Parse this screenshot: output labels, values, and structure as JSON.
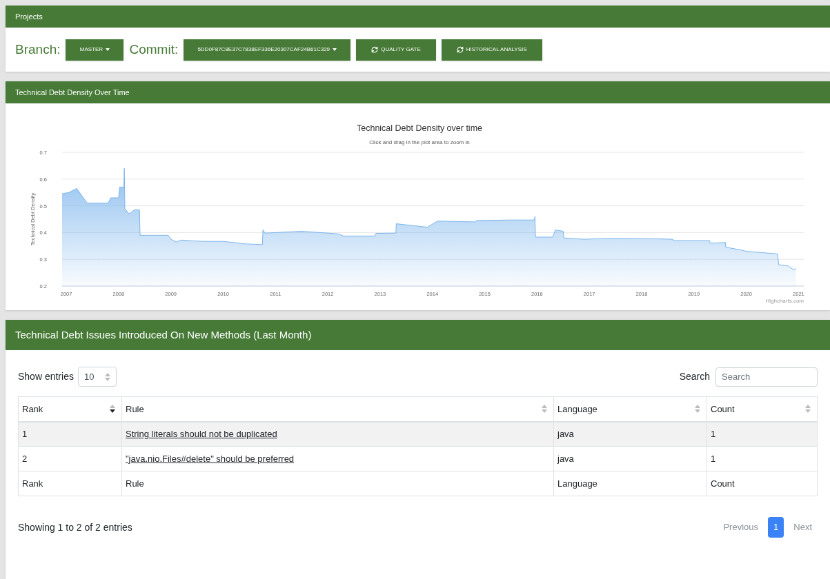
{
  "projects_panel": {
    "title": "Projects",
    "branch_label": "Branch:",
    "branch": "MASTER",
    "commit_label": "Commit:",
    "commit": "5DD0F87C8E37C7838EF336E20307CAF24B61C329",
    "actions": [
      {
        "label": "QUALITY GATE"
      },
      {
        "label": "HISTORICAL ANALYSIS"
      }
    ]
  },
  "chart_panel": {
    "title": "Technical Debt Density Over Time",
    "subtitle": "Click and drag in the plot area to zoom in",
    "credit": "Highcharts.com",
    "chart_data": {
      "type": "area",
      "grid": true,
      "title": "Technical Debt Density over time",
      "ylabel": "Technical Debt Density",
      "xlim": [
        2006.92,
        2021.1
      ],
      "ylim": [
        0.2,
        0.7
      ],
      "xticks": [
        2007,
        2008,
        2009,
        2010,
        2011,
        2012,
        2013,
        2014,
        2015,
        2016,
        2017,
        2018,
        2019,
        2020,
        2021
      ],
      "yticks": [
        0.2,
        0.3,
        0.4,
        0.5,
        0.6,
        0.7
      ],
      "x": [
        2006.92,
        2007.05,
        2007.2,
        2007.4,
        2007.8,
        2007.85,
        2008.0,
        2008.02,
        2008.1,
        2008.11,
        2008.12,
        2008.2,
        2008.3,
        2008.4,
        2008.41,
        2008.95,
        2009.0,
        2009.1,
        2009.2,
        2009.6,
        2010.0,
        2010.2,
        2010.4,
        2010.75,
        2010.76,
        2010.8,
        2011.5,
        2012.2,
        2012.3,
        2012.9,
        2012.92,
        2013.3,
        2013.31,
        2013.9,
        2014.1,
        2014.8,
        2014.85,
        2015.45,
        2015.95,
        2015.96,
        2015.97,
        2016.3,
        2016.35,
        2016.5,
        2016.51,
        2016.9,
        2017.35,
        2017.9,
        2018.6,
        2018.61,
        2019.3,
        2019.31,
        2019.6,
        2019.61,
        2019.9,
        2020.0,
        2020.3,
        2020.6,
        2020.62,
        2020.8,
        2020.9,
        2020.95
      ],
      "series": [
        {
          "color": "#7cb5ec",
          "values": [
            0.545,
            0.55,
            0.565,
            0.51,
            0.51,
            0.53,
            0.53,
            0.57,
            0.57,
            0.64,
            0.49,
            0.47,
            0.485,
            0.485,
            0.39,
            0.39,
            0.375,
            0.365,
            0.372,
            0.367,
            0.367,
            0.363,
            0.358,
            0.355,
            0.41,
            0.398,
            0.405,
            0.395,
            0.387,
            0.387,
            0.397,
            0.398,
            0.433,
            0.42,
            0.443,
            0.44,
            0.445,
            0.447,
            0.447,
            0.46,
            0.383,
            0.383,
            0.41,
            0.405,
            0.38,
            0.375,
            0.378,
            0.378,
            0.375,
            0.37,
            0.37,
            0.36,
            0.363,
            0.345,
            0.335,
            0.33,
            0.325,
            0.32,
            0.28,
            0.275,
            0.262,
            0.265
          ]
        }
      ]
    }
  },
  "issues_panel": {
    "title": "Technical Debt Issues Introduced On New Methods (Last Month)",
    "show_entries_label": "Show entries",
    "page_size": "10",
    "search_label": "Search",
    "search_placeholder": "Search",
    "columns": [
      {
        "label": "Rank",
        "sorted": true
      },
      {
        "label": "Rule",
        "sorted": false
      },
      {
        "label": "Language",
        "sorted": false
      },
      {
        "label": "Count",
        "sorted": false
      }
    ],
    "rows": [
      {
        "rank": "1",
        "rule": "String literals should not be duplicated",
        "language": "java",
        "count": "1",
        "hovered": true
      },
      {
        "rank": "2",
        "rule": "\"java.nio.Files#delete\" should be preferred",
        "language": "java",
        "count": "1",
        "hovered": false
      }
    ],
    "footer": [
      "Rank",
      "Rule",
      "Language",
      "Count"
    ],
    "info": "Showing 1 to 2 of 2 entries",
    "pagination": [
      {
        "label": "Previous",
        "selected": false,
        "disabled": true
      },
      {
        "label": "1",
        "selected": true,
        "disabled": false
      },
      {
        "label": "Next",
        "selected": false,
        "disabled": true
      }
    ]
  }
}
